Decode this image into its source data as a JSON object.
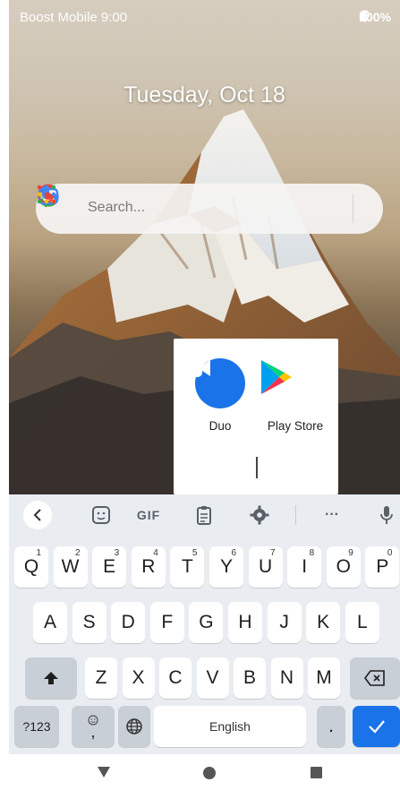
{
  "status_bar": {
    "carrier_time": "Boost Mobile  9:00",
    "battery": "100%",
    "icons": [
      "location-icon",
      "wifi-icon",
      "battery-icon"
    ]
  },
  "home": {
    "date": "Tuesday, Oct 18",
    "search": {
      "placeholder": "Search..."
    }
  },
  "folder_popup": {
    "apps": [
      {
        "label": "Duo",
        "icon": "duo-icon",
        "color": "#1a73e8"
      },
      {
        "label": "Play Store",
        "icon": "play-store-icon"
      }
    ]
  },
  "keyboard": {
    "toolbar": {
      "gif": "GIF",
      "more": "···"
    },
    "row1": [
      {
        "k": "Q",
        "n": "1"
      },
      {
        "k": "W",
        "n": "2"
      },
      {
        "k": "E",
        "n": "3"
      },
      {
        "k": "R",
        "n": "4"
      },
      {
        "k": "T",
        "n": "5"
      },
      {
        "k": "Y",
        "n": "6"
      },
      {
        "k": "U",
        "n": "7"
      },
      {
        "k": "I",
        "n": "8"
      },
      {
        "k": "O",
        "n": "9"
      },
      {
        "k": "P",
        "n": "0"
      }
    ],
    "row2": [
      "A",
      "S",
      "D",
      "F",
      "G",
      "H",
      "J",
      "K",
      "L"
    ],
    "row3": [
      "Z",
      "X",
      "C",
      "V",
      "B",
      "N",
      "M"
    ],
    "symbols_key": "?123",
    "comma_key": ",",
    "space_label": "English",
    "period_key": ".",
    "accent_color": "#1a73e8"
  }
}
